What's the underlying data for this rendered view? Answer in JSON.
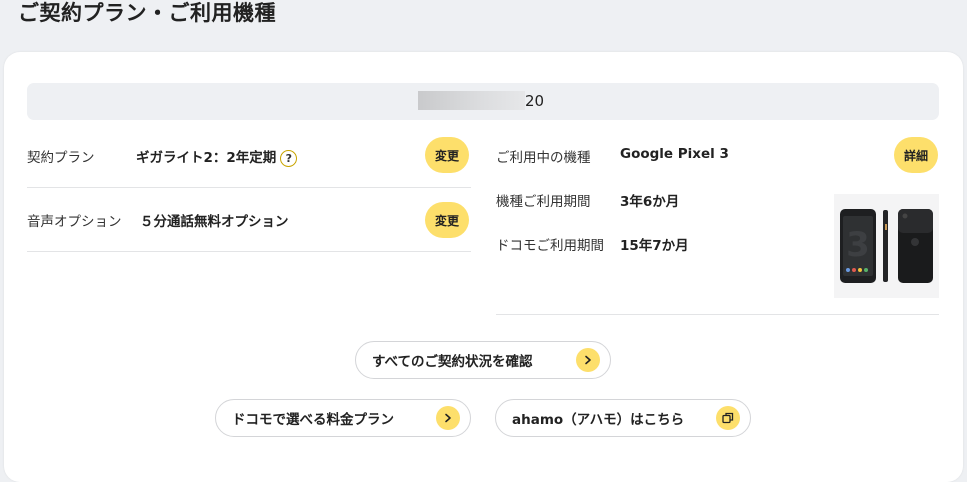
{
  "header": {
    "title": "ご契約プラン・ご利用機種"
  },
  "number_bar": {
    "suffix": "20"
  },
  "left": {
    "plan": {
      "label": "契約プラン",
      "value": "ギガライト2：2年定期",
      "help": "?",
      "change_label": "変更"
    },
    "voice": {
      "label": "音声オプション",
      "value": "５分通話無料オプション",
      "change_label": "変更"
    }
  },
  "right": {
    "device": {
      "label": "ご利用中の機種",
      "value": "Google Pixel 3",
      "detail_label": "詳細"
    },
    "device_period": {
      "label": "機種ご利用期間",
      "value": "3年6か月"
    },
    "docomo_period": {
      "label": "ドコモご利用期間",
      "value": "15年7か月"
    }
  },
  "links": {
    "all_contracts": "すべてのご契約状況を確認",
    "plans": "ドコモで選べる料金プラン",
    "ahamo": "ahamo（アハモ）はこちら"
  },
  "icons": {
    "help": "help-icon",
    "chevron": "chevron-right-icon",
    "external": "external-window-icon",
    "phone": "phone-image"
  },
  "colors": {
    "accent": "#fddf6b",
    "background": "#eef0f3"
  }
}
